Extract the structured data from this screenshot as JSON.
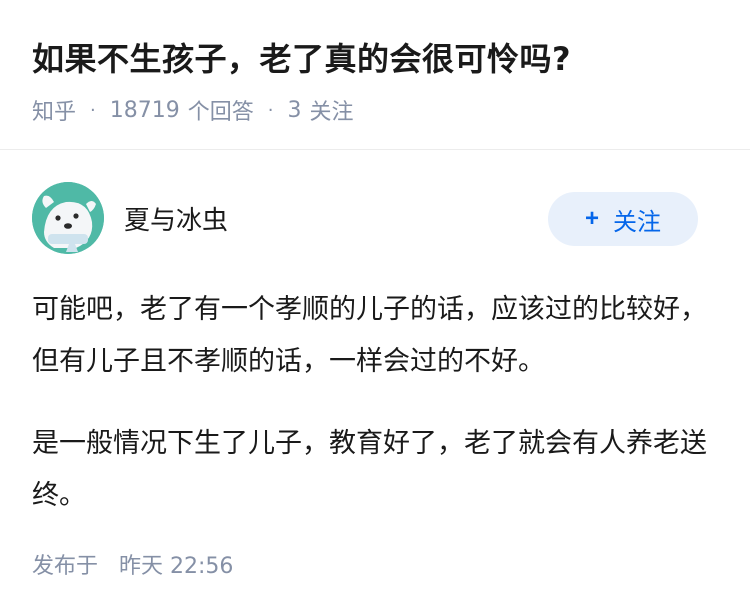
{
  "question": {
    "title": "如果不生孩子，老了真的会很可怜吗?",
    "source": "知乎",
    "answer_count": "18719",
    "answer_label": "个回答",
    "follower_count": "3",
    "follower_label": "关注",
    "separator": "·"
  },
  "author": {
    "name": "夏与冰虫",
    "avatar_icon": "cartoon-dog-avatar",
    "avatar_color": "#4fb9a6"
  },
  "follow_button": {
    "plus": "+",
    "label": "关注",
    "bg_color": "#e8f0fb",
    "text_color": "#0566ea"
  },
  "answer": {
    "paragraphs": [
      "可能吧，老了有一个孝顺的儿子的话，应该过的比较好，但有儿子且不孝顺的话，一样会过的不好。",
      "是一般情况下生了儿子，教育好了，老了就会有人养老送终。"
    ]
  },
  "publish": {
    "label": "发布于",
    "time": "昨天 22:56"
  }
}
